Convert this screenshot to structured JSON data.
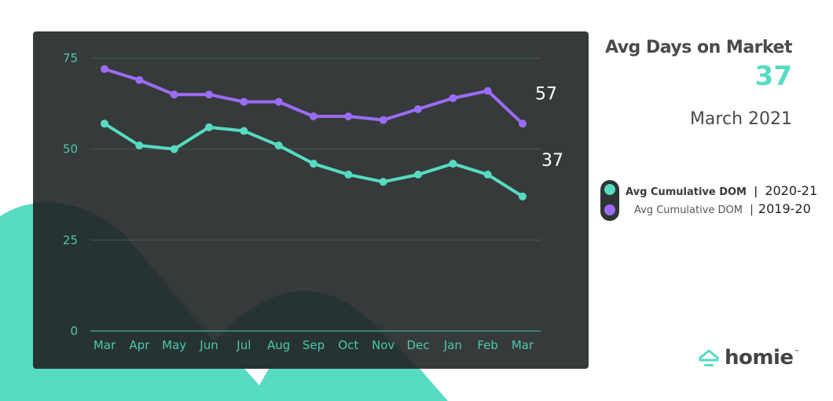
{
  "header": {
    "title": "Avg Days on Market",
    "current_value": "37",
    "period": "March 2021"
  },
  "legend": [
    {
      "name": "Avg Cumulative DOM",
      "separator": "|",
      "period": "2020-21",
      "color": "#56dbc2"
    },
    {
      "name": "Avg Cumulative DOM",
      "separator": "|",
      "period": "2019-20",
      "color": "#9b6cf5"
    }
  ],
  "logo": {
    "text": "homie",
    "tm": "™",
    "icon": "house-roof-icon"
  },
  "colors": {
    "teal": "#56dbc2",
    "purple": "#9b6cf5",
    "card_bg": "#2f3434",
    "grid": "#3d5a52",
    "axis_text": "#4fc7ad"
  },
  "chart_data": {
    "type": "line",
    "title": "Avg Days on Market",
    "xlabel": "",
    "ylabel": "",
    "categories": [
      "Mar",
      "Apr",
      "May",
      "Jun",
      "Jul",
      "Aug",
      "Sep",
      "Oct",
      "Nov",
      "Dec",
      "Jan",
      "Feb",
      "Mar"
    ],
    "ylim": [
      0,
      75
    ],
    "yticks": [
      0,
      25,
      50,
      75
    ],
    "grid": true,
    "legend_position": "right",
    "series": [
      {
        "name": "Avg Cumulative DOM | 2019-20",
        "color": "#9b6cf5",
        "values": [
          72,
          69,
          65,
          65,
          63,
          63,
          59,
          59,
          58,
          61,
          64,
          66,
          57
        ],
        "end_label": "57"
      },
      {
        "name": "Avg Cumulative DOM | 2020-21",
        "color": "#56dbc2",
        "values": [
          57,
          51,
          50,
          56,
          55,
          51,
          46,
          43,
          41,
          43,
          46,
          43,
          37
        ],
        "end_label": "37"
      }
    ]
  }
}
